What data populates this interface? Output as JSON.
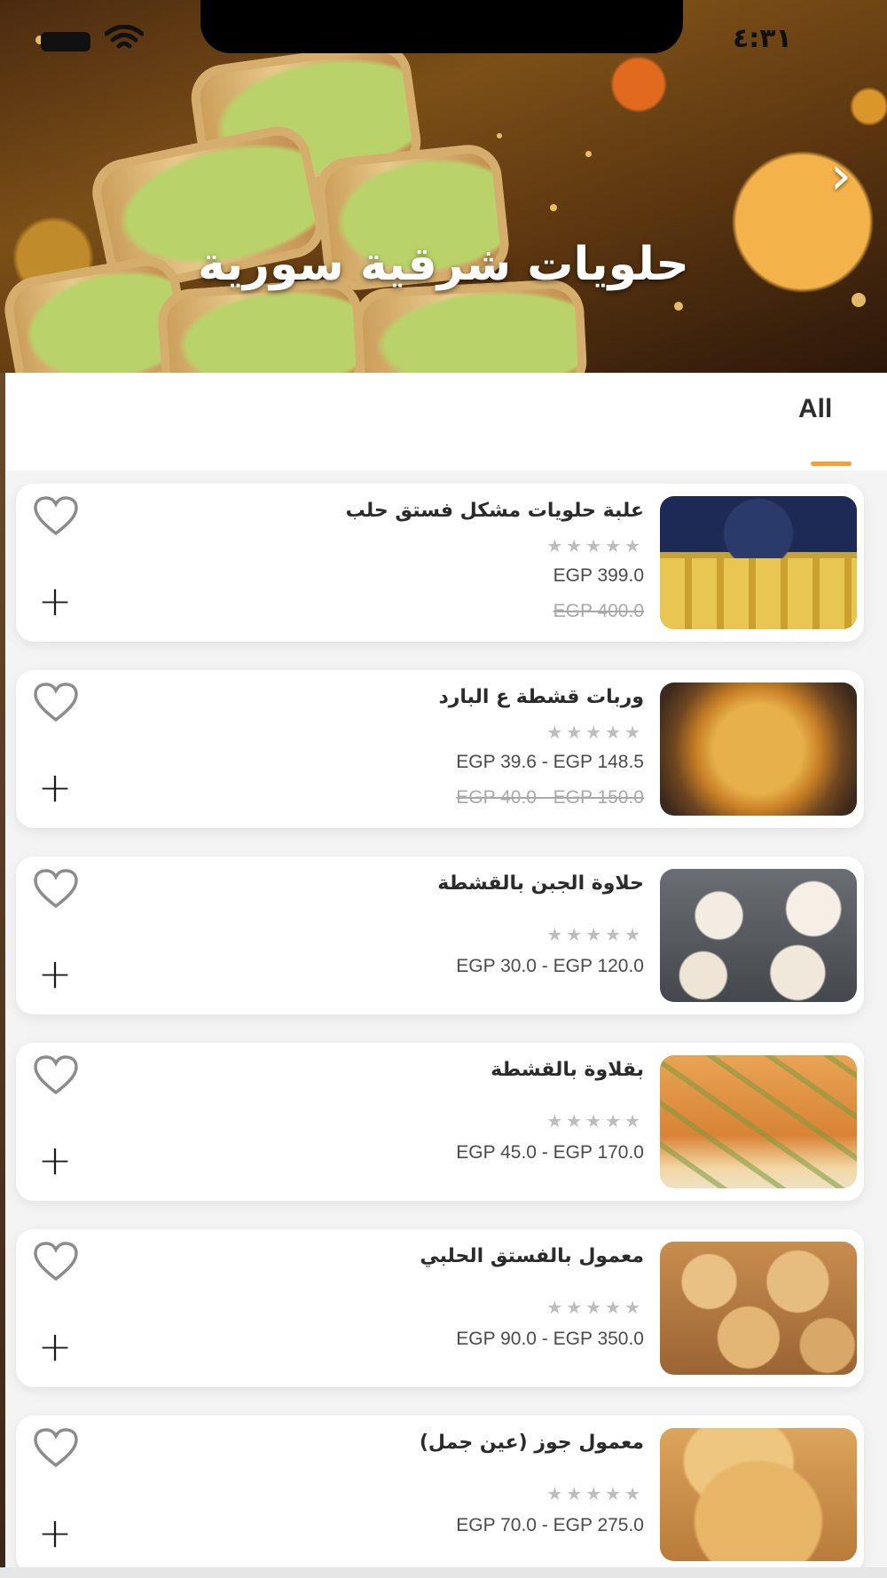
{
  "status_bar": {
    "time": "٤:٣١"
  },
  "hero": {
    "title": "حلويات شرقية سورية",
    "next_icon": "chevron-right-icon"
  },
  "tabs": [
    {
      "label": "All",
      "active": true
    }
  ],
  "colors": {
    "accent": "#f2a23a",
    "star": "#bdbdbd",
    "card_bg": "#ffffff",
    "page_bg": "#f4f4f4"
  },
  "products": [
    {
      "name": "علبة حلويات مشكل فستق حلب",
      "price": "EGP 399.0",
      "old_price": "EGP 400.0",
      "rating": 0
    },
    {
      "name": "وربات قشطة ع البارد",
      "price": "EGP 39.6 - EGP 148.5",
      "old_price": "EGP 40.0 - EGP 150.0",
      "rating": 0
    },
    {
      "name": "حلاوة الجبن بالقشطة",
      "price": "EGP 30.0 - EGP 120.0",
      "old_price": "",
      "rating": 0
    },
    {
      "name": "بقلاوة بالقشطة",
      "price": "EGP 45.0 - EGP 170.0",
      "old_price": "",
      "rating": 0
    },
    {
      "name": "معمول بالفستق الحلبي",
      "price": "EGP 90.0 - EGP 350.0",
      "old_price": "",
      "rating": 0
    },
    {
      "name": "معمول جوز (عين جمل)",
      "price": "EGP 70.0 - EGP 275.0",
      "old_price": "",
      "rating": 0
    }
  ],
  "icons": {
    "favorite": "heart-outline-icon",
    "add": "plus-icon",
    "rating": "star-icon"
  }
}
